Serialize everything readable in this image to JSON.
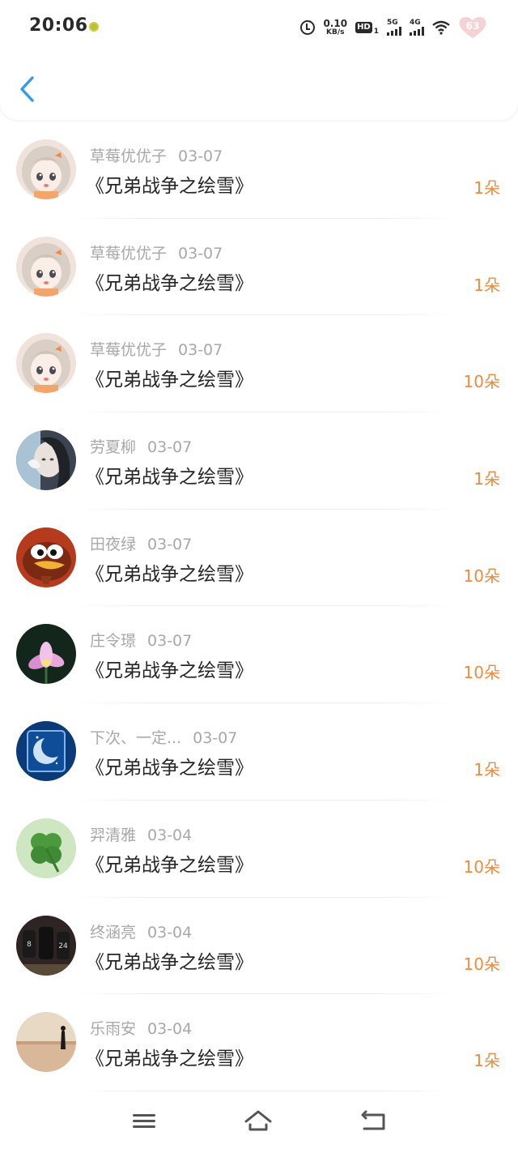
{
  "status": {
    "time": "20:06",
    "net_speed_value": "0.10",
    "net_speed_unit": "KB/s",
    "hd_label": "HD",
    "hd_sub": "1",
    "sim1_label": "5G",
    "sim2_label": "4G",
    "battery": "63"
  },
  "nav": {
    "back_icon": "chevron-left-icon"
  },
  "colors": {
    "accent": "#2e9bf0",
    "amount": "#f08a3c",
    "meta": "#a8a8a8"
  },
  "records": [
    {
      "name": "草莓优优子",
      "date": "03-07",
      "title": "《兄弟战争之绘雪》",
      "amount": "1朵",
      "avatar": "anime-girl"
    },
    {
      "name": "草莓优优子",
      "date": "03-07",
      "title": "《兄弟战争之绘雪》",
      "amount": "1朵",
      "avatar": "anime-girl"
    },
    {
      "name": "草莓优优子",
      "date": "03-07",
      "title": "《兄弟战争之绘雪》",
      "amount": "10朵",
      "avatar": "anime-girl"
    },
    {
      "name": "劳夏柳",
      "date": "03-07",
      "title": "《兄弟战争之绘雪》",
      "amount": "1朵",
      "avatar": "woman-photo"
    },
    {
      "name": "田夜绿",
      "date": "03-07",
      "title": "《兄弟战争之绘雪》",
      "amount": "10朵",
      "avatar": "cartoon-bird"
    },
    {
      "name": "庄令璟",
      "date": "03-07",
      "title": "《兄弟战争之绘雪》",
      "amount": "10朵",
      "avatar": "lotus"
    },
    {
      "name": "下次、一定...",
      "date": "03-07",
      "title": "《兄弟战争之绘雪》",
      "amount": "1朵",
      "avatar": "moon"
    },
    {
      "name": "羿清雅",
      "date": "03-04",
      "title": "《兄弟战争之绘雪》",
      "amount": "10朵",
      "avatar": "clover"
    },
    {
      "name": "终涵亮",
      "date": "03-04",
      "title": "《兄弟战争之绘雪》",
      "amount": "10朵",
      "avatar": "basketball"
    },
    {
      "name": "乐雨安",
      "date": "03-04",
      "title": "《兄弟战争之绘雪》",
      "amount": "1朵",
      "avatar": "sunset"
    }
  ],
  "bottom_nav": {
    "menu_icon": "menu-icon",
    "home_icon": "home-icon",
    "back_icon": "back-icon"
  }
}
